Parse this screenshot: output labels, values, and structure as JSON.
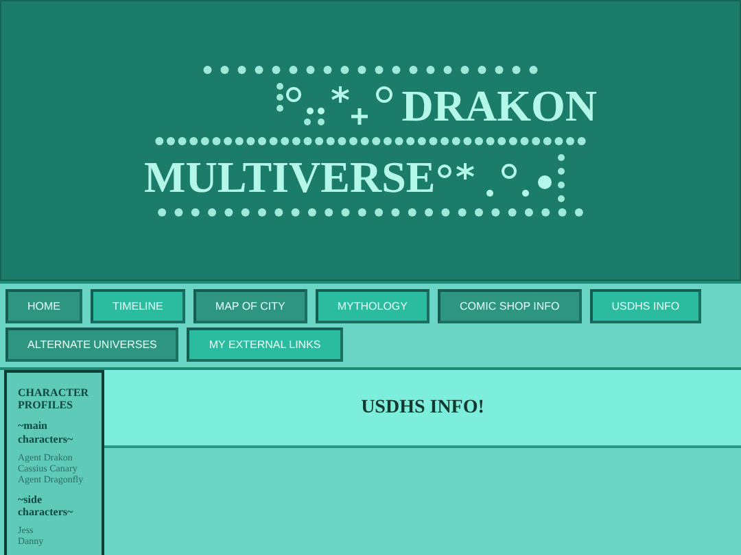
{
  "header": {
    "logo_line_1": "DRAKON",
    "logo_line_2": "MULTIVERSE"
  },
  "nav": [
    {
      "label": "HOME",
      "kind": "dark"
    },
    {
      "label": "TIMELINE",
      "kind": "light"
    },
    {
      "label": "MAP OF CITY",
      "kind": "dark"
    },
    {
      "label": "MYTHOLOGY",
      "kind": "light"
    },
    {
      "label": "COMIC SHOP INFO",
      "kind": "dark"
    },
    {
      "label": "USDHS INFO",
      "kind": "light"
    },
    {
      "label": "ALTERNATE UNIVERSES",
      "kind": "dark"
    },
    {
      "label": "MY EXTERNAL LINKS",
      "kind": "light"
    }
  ],
  "sidebar": {
    "title": "CHARACTER PROFILES",
    "sections": [
      {
        "heading": "~main characters~",
        "items": [
          "Agent Drakon",
          "Cassius Canary",
          "Agent Dragonfly"
        ]
      },
      {
        "heading": "~side characters~",
        "items": [
          "Jess",
          "Danny"
        ]
      }
    ]
  },
  "main": {
    "heading": "USDHS INFO!"
  }
}
